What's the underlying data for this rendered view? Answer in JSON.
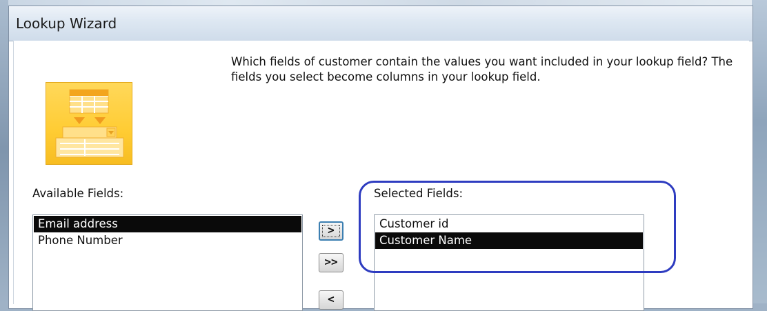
{
  "window": {
    "title": "Lookup Wizard"
  },
  "instructions": "Which fields of customer contain the values you want included in your lookup field? The fields you select become columns in your lookup field.",
  "available": {
    "label": "Available Fields:",
    "items": [
      {
        "label": "Email address",
        "selected": true
      },
      {
        "label": "Phone Number",
        "selected": false
      }
    ]
  },
  "selected": {
    "label": "Selected Fields:",
    "items": [
      {
        "label": "Customer id",
        "selected": false
      },
      {
        "label": "Customer Name",
        "selected": true
      }
    ]
  },
  "buttons": {
    "add_one": ">",
    "add_all": ">>",
    "remove_one": "<"
  },
  "colors": {
    "selection_bg": "#0a0a0a",
    "annotation_ring": "#2e3cc0",
    "wizard_graphic": "#ffcc33"
  },
  "icons": {
    "wizard_graphic": "table-to-lookup-icon"
  }
}
